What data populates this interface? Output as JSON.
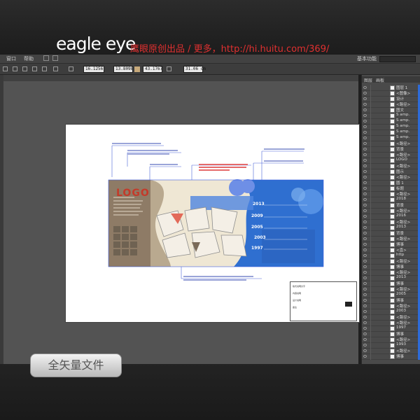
{
  "watermark": {
    "logo_text": "eagle eye",
    "caption": "鹰眼原创出品 / 更多，http://hi.huitu.com/369/"
  },
  "menu_bar": {
    "items": [
      "窗口",
      "帮助"
    ],
    "workspace_label": "基本功能"
  },
  "control_bar": {
    "fields": [
      "16.1256",
      "13.8098",
      "43.1767",
      "31.06 cm"
    ]
  },
  "layers_panel": {
    "tabs": [
      "图层",
      "画板"
    ],
    "rows": [
      "图层 1",
      "<图像>",
      "设计",
      "<路径>",
      "图文",
      "S amp.",
      "S amp.",
      "S amp.",
      "S amp.",
      "S amp.",
      "<路径>",
      "背景",
      "<路径>",
      "LOGO",
      "<路径>",
      "图示",
      "<路径>",
      "圆 1",
      "标题",
      "<路径>",
      "2018",
      "背景",
      "<路径>",
      "2016",
      "<路径>",
      "2013",
      "背景",
      "<路径>",
      "博事",
      "<直>",
      "http",
      "<路径>",
      "博事",
      "<路径>",
      "2013",
      "博事",
      "<路径>",
      "2005",
      "博事",
      "<路径>",
      "2003",
      "<路径>",
      "<路径>",
      "1997",
      "博事",
      "<路径>",
      "1993",
      "<路径>",
      "博事"
    ]
  },
  "artboard": {
    "design_logo": "LOGO",
    "years": [
      "2013",
      "2009",
      "2005",
      "2003",
      "1997"
    ],
    "note_lines": [
      "版式说明文字",
      "内容说明",
      "设计说明",
      "备注"
    ]
  },
  "badge": {
    "label": "全矢量文件"
  },
  "colors": {
    "brand_red": "#e03030",
    "panel_bg": "#4a4a4a",
    "workspace_bg": "#535353",
    "design_blue": "#2f6fd0",
    "design_cream": "#efe7d4",
    "design_taupe": "#8e7b66",
    "selection_blue": "#2d6bd8"
  }
}
